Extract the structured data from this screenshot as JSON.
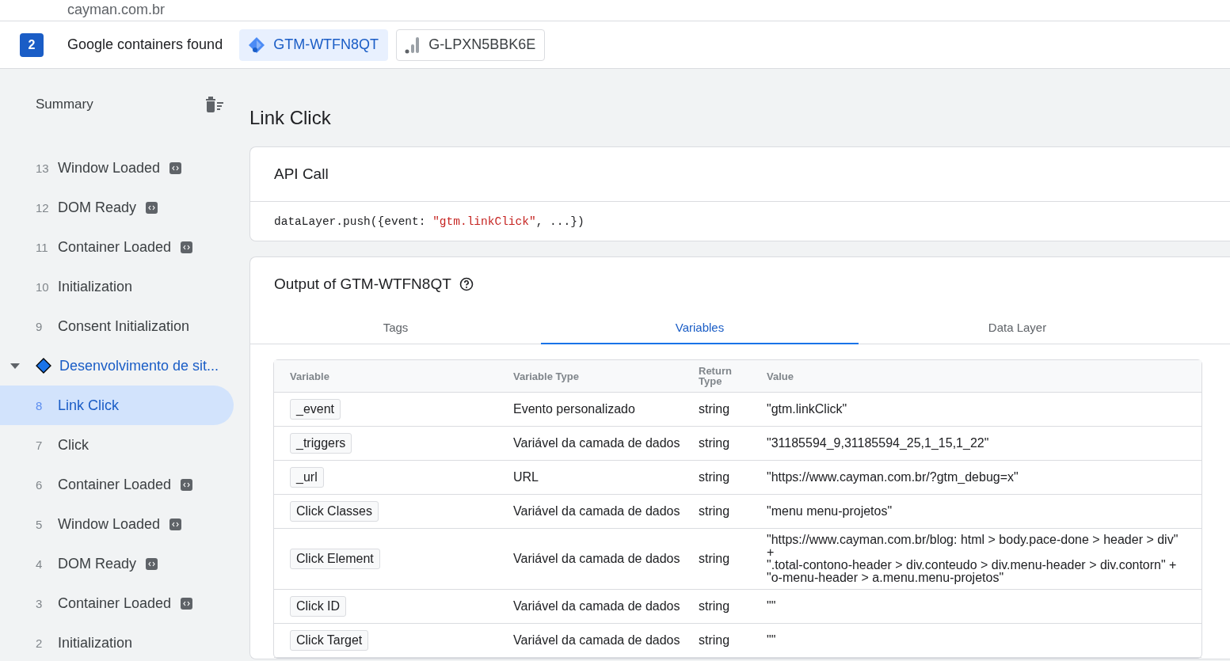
{
  "site": {
    "domain": "cayman.com.br"
  },
  "containers_bar": {
    "count": "2",
    "label": "Google containers found",
    "containers": [
      {
        "kind": "gtm",
        "id": "GTM-WTFN8QT",
        "selected": true
      },
      {
        "kind": "ga",
        "id": "G-LPXN5BBK6E",
        "selected": false
      }
    ]
  },
  "sidebar": {
    "title": "Summary",
    "items": [
      {
        "kind": "event",
        "number": "13",
        "label": "Window Loaded",
        "api": true,
        "selected": false
      },
      {
        "kind": "event",
        "number": "12",
        "label": "DOM Ready",
        "api": true,
        "selected": false
      },
      {
        "kind": "event",
        "number": "11",
        "label": "Container Loaded",
        "api": true,
        "selected": false
      },
      {
        "kind": "event",
        "number": "10",
        "label": "Initialization",
        "api": false,
        "selected": false
      },
      {
        "kind": "event",
        "number": "9",
        "label": "Consent Initialization",
        "api": false,
        "selected": false
      },
      {
        "kind": "group",
        "label": "Desenvolvimento de sit...",
        "expanded": true,
        "children": [
          {
            "kind": "event",
            "number": "8",
            "label": "Link Click",
            "api": false,
            "selected": true
          },
          {
            "kind": "event",
            "number": "7",
            "label": "Click",
            "api": false,
            "selected": false
          },
          {
            "kind": "event",
            "number": "6",
            "label": "Container Loaded",
            "api": true,
            "selected": false
          },
          {
            "kind": "event",
            "number": "5",
            "label": "Window Loaded",
            "api": true,
            "selected": false
          },
          {
            "kind": "event",
            "number": "4",
            "label": "DOM Ready",
            "api": true,
            "selected": false
          },
          {
            "kind": "event",
            "number": "3",
            "label": "Container Loaded",
            "api": true,
            "selected": false
          },
          {
            "kind": "event",
            "number": "2",
            "label": "Initialization",
            "api": false,
            "selected": false
          }
        ]
      }
    ]
  },
  "main": {
    "title": "Link Click",
    "api_call": {
      "heading": "API Call",
      "code_prefix": "dataLayer.push({event: ",
      "code_string": "\"gtm.linkClick\"",
      "code_suffix": ", ...})"
    },
    "output": {
      "heading": "Output of GTM-WTFN8QT",
      "tabs": [
        {
          "label": "Tags",
          "selected": false
        },
        {
          "label": "Variables",
          "selected": true
        },
        {
          "label": "Data Layer",
          "selected": false
        }
      ],
      "table": {
        "columns": [
          "Variable",
          "Variable Type",
          "Return Type",
          "Value"
        ],
        "rows": [
          {
            "variable": "_event",
            "type": "Evento personalizado",
            "return_type": "string",
            "value": "\"gtm.linkClick\""
          },
          {
            "variable": "_triggers",
            "type": "Variável da camada de dados",
            "return_type": "string",
            "value": "\"31185594_9,31185594_25,1_15,1_22\""
          },
          {
            "variable": "_url",
            "type": "URL",
            "return_type": "string",
            "value": "\"https://www.cayman.com.br/?gtm_debug=x\""
          },
          {
            "variable": "Click Classes",
            "type": "Variável da camada de dados",
            "return_type": "string",
            "value": "\"menu menu-projetos\""
          },
          {
            "variable": "Click Element",
            "type": "Variável da camada de dados",
            "return_type": "string",
            "value": "\"https://www.cayman.com.br/blog: html > body.pace-done > header > div\"\n+\n\".total-contono-header > div.conteudo > div.menu-header > div.contorn\" +\n\"o-menu-header > a.menu.menu-projetos\""
          },
          {
            "variable": "Click ID",
            "type": "Variável da camada de dados",
            "return_type": "string",
            "value": "\"\""
          },
          {
            "variable": "Click Target",
            "type": "Variável da camada de dados",
            "return_type": "string",
            "value": "\"\""
          }
        ]
      }
    }
  }
}
